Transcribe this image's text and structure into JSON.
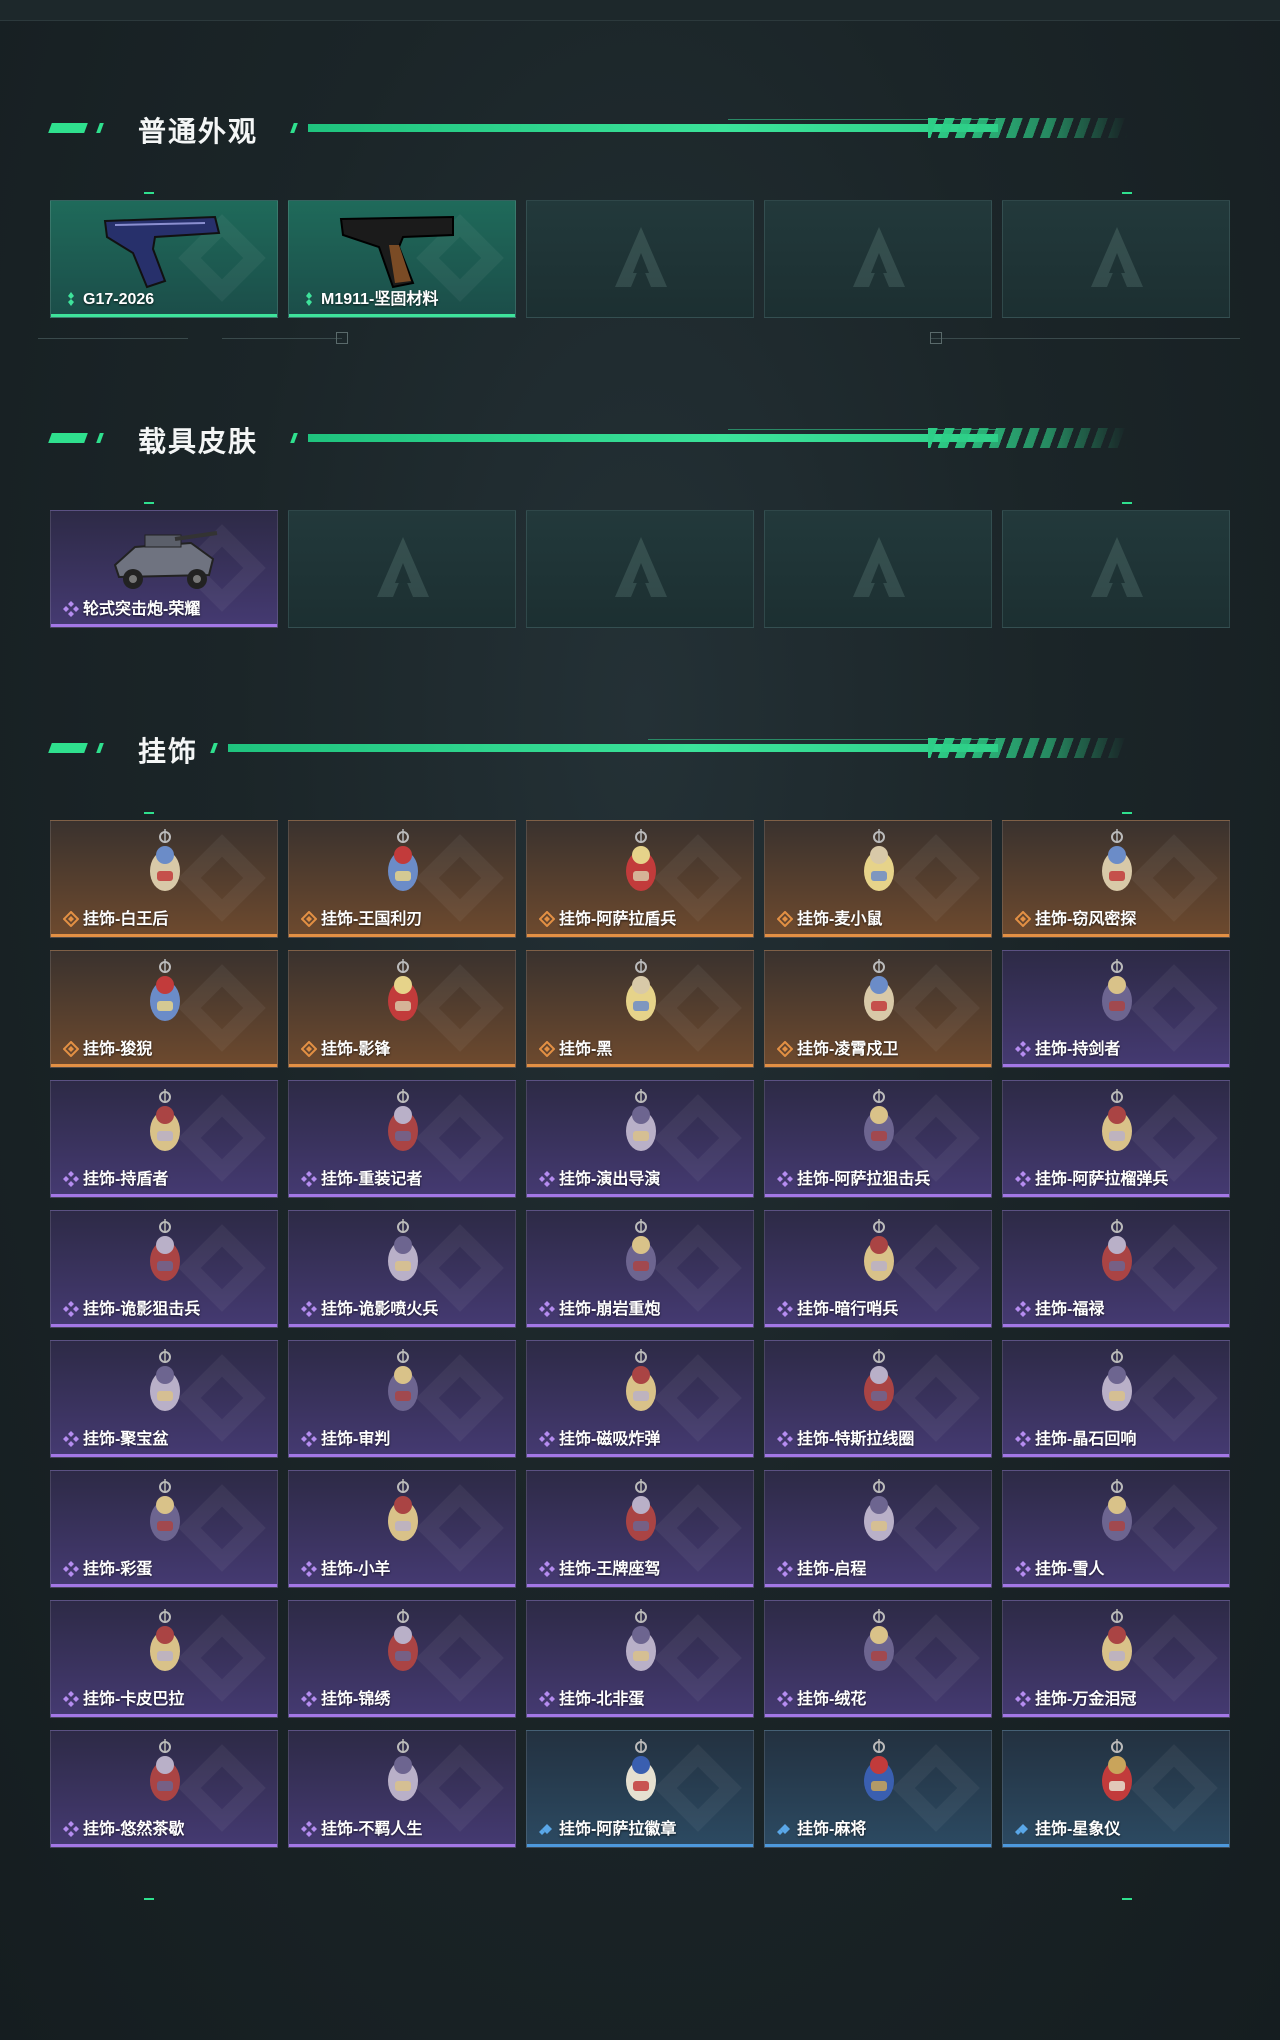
{
  "sections": [
    {
      "title": "普通外观",
      "cards": [
        {
          "label": "G17-2026",
          "rarity": "green",
          "icon": "pistol-icon"
        },
        {
          "label": "M1911-坚固材料",
          "rarity": "green",
          "icon": "pistol-icon"
        },
        {
          "label": "",
          "rarity": "empty"
        },
        {
          "label": "",
          "rarity": "empty"
        },
        {
          "label": "",
          "rarity": "empty"
        }
      ]
    },
    {
      "title": "载具皮肤",
      "cards": [
        {
          "label": "轮式突击炮-荣耀",
          "rarity": "purple",
          "icon": "vehicle-icon"
        },
        {
          "label": "",
          "rarity": "empty"
        },
        {
          "label": "",
          "rarity": "empty"
        },
        {
          "label": "",
          "rarity": "empty"
        },
        {
          "label": "",
          "rarity": "empty"
        }
      ]
    },
    {
      "title": "挂饰",
      "cards": [
        {
          "label": "挂饰-白王后",
          "rarity": "orange"
        },
        {
          "label": "挂饰-王国利刃",
          "rarity": "orange"
        },
        {
          "label": "挂饰-阿萨拉盾兵",
          "rarity": "orange"
        },
        {
          "label": "挂饰-麦小鼠",
          "rarity": "orange"
        },
        {
          "label": "挂饰-窃风密探",
          "rarity": "orange"
        },
        {
          "label": "挂饰-狻猊",
          "rarity": "orange"
        },
        {
          "label": "挂饰-影锋",
          "rarity": "orange"
        },
        {
          "label": "挂饰-黑",
          "rarity": "orange"
        },
        {
          "label": "挂饰-凌霄戍卫",
          "rarity": "orange"
        },
        {
          "label": "挂饰-持剑者",
          "rarity": "purple"
        },
        {
          "label": "挂饰-持盾者",
          "rarity": "purple"
        },
        {
          "label": "挂饰-重装记者",
          "rarity": "purple"
        },
        {
          "label": "挂饰-演出导演",
          "rarity": "purple"
        },
        {
          "label": "挂饰-阿萨拉狙击兵",
          "rarity": "purple"
        },
        {
          "label": "挂饰-阿萨拉榴弹兵",
          "rarity": "purple"
        },
        {
          "label": "挂饰-诡影狙击兵",
          "rarity": "purple"
        },
        {
          "label": "挂饰-诡影喷火兵",
          "rarity": "purple"
        },
        {
          "label": "挂饰-崩岩重炮",
          "rarity": "purple"
        },
        {
          "label": "挂饰-暗行哨兵",
          "rarity": "purple"
        },
        {
          "label": "挂饰-福禄",
          "rarity": "purple"
        },
        {
          "label": "挂饰-聚宝盆",
          "rarity": "purple"
        },
        {
          "label": "挂饰-审判",
          "rarity": "purple"
        },
        {
          "label": "挂饰-磁吸炸弹",
          "rarity": "purple"
        },
        {
          "label": "挂饰-特斯拉线圈",
          "rarity": "purple"
        },
        {
          "label": "挂饰-晶石回响",
          "rarity": "purple"
        },
        {
          "label": "挂饰-彩蛋",
          "rarity": "purple"
        },
        {
          "label": "挂饰-小羊",
          "rarity": "purple"
        },
        {
          "label": "挂饰-王牌座驾",
          "rarity": "purple"
        },
        {
          "label": "挂饰-启程",
          "rarity": "purple"
        },
        {
          "label": "挂饰-雪人",
          "rarity": "purple"
        },
        {
          "label": "挂饰-卡皮巴拉",
          "rarity": "purple"
        },
        {
          "label": "挂饰-锦绣",
          "rarity": "purple"
        },
        {
          "label": "挂饰-北非蛋",
          "rarity": "purple"
        },
        {
          "label": "挂饰-绒花",
          "rarity": "purple"
        },
        {
          "label": "挂饰-万金泪冠",
          "rarity": "purple"
        },
        {
          "label": "挂饰-悠然茶歇",
          "rarity": "purple"
        },
        {
          "label": "挂饰-不羁人生",
          "rarity": "purple"
        },
        {
          "label": "挂饰-阿萨拉徽章",
          "rarity": "blue"
        },
        {
          "label": "挂饰-麻将",
          "rarity": "blue"
        },
        {
          "label": "挂饰-星象仪",
          "rarity": "blue"
        }
      ]
    }
  ],
  "colors": {
    "accent": "#2fe08e",
    "orange": "#e39044",
    "purple": "#a377e6",
    "blue": "#4d99dd",
    "green": "#3ee39b"
  }
}
